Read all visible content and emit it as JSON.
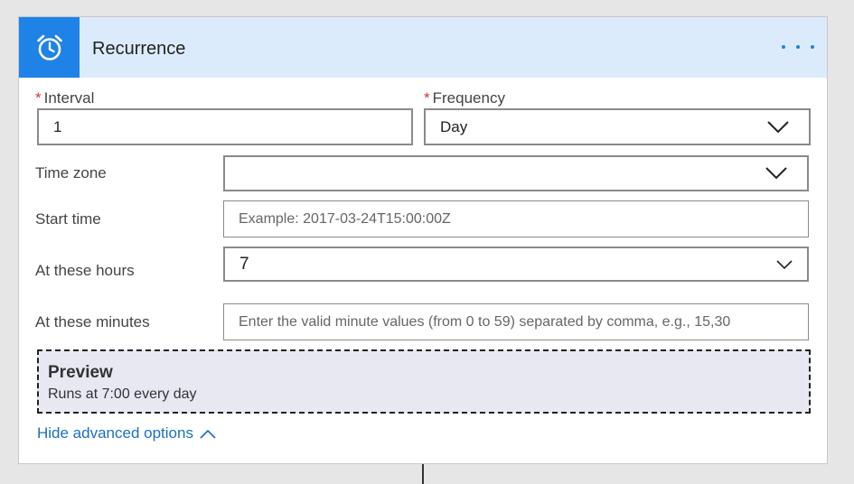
{
  "header": {
    "title": "Recurrence",
    "icon": "alarm-clock-icon",
    "accent": "#1e82e6"
  },
  "fields": {
    "interval": {
      "label": "Interval",
      "required": "*",
      "value": "1"
    },
    "frequency": {
      "label": "Frequency",
      "required": "*",
      "value": "Day"
    },
    "time_zone": {
      "label": "Time zone",
      "value": ""
    },
    "start_time": {
      "label": "Start time",
      "placeholder": "Example: 2017-03-24T15:00:00Z"
    },
    "at_these_hours": {
      "label": "At these hours",
      "value": "7"
    },
    "at_these_minutes": {
      "label": "At these minutes",
      "placeholder": "Enter the valid minute values (from 0 to 59) separated by comma, e.g., 15,30"
    }
  },
  "preview": {
    "title": "Preview",
    "description": "Runs at 7:00 every day"
  },
  "advanced_toggle": {
    "label": "Hide advanced options"
  }
}
